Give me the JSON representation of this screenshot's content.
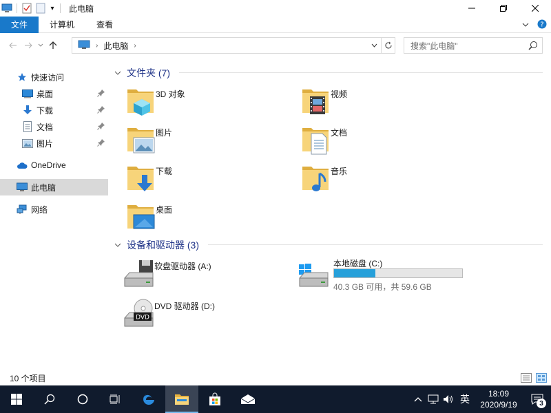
{
  "window": {
    "title": "此电脑",
    "qa_dropdown": "▾"
  },
  "ribbon": {
    "tabs": [
      "文件",
      "计算机",
      "查看"
    ]
  },
  "address": {
    "location": "此电脑",
    "search_placeholder": "搜索\"此电脑\""
  },
  "sidebar": {
    "quick_access": "快速访问",
    "items": [
      "桌面",
      "下载",
      "文档",
      "图片"
    ],
    "onedrive": "OneDrive",
    "this_pc": "此电脑",
    "network": "网络"
  },
  "folders_group": {
    "title": "文件夹 (7)",
    "items": [
      "3D 对象",
      "视频",
      "图片",
      "文档",
      "下载",
      "音乐",
      "桌面"
    ]
  },
  "devices_group": {
    "title": "设备和驱动器 (3)",
    "floppy": "软盘驱动器 (A:)",
    "local_disk": "本地磁盘 (C:)",
    "local_disk_free": "40.3 GB 可用，共 59.6 GB",
    "local_disk_used_fraction": 0.32,
    "dvd": "DVD 驱动器 (D:)",
    "dvd_text": "DVD"
  },
  "status": {
    "count": "10 个项目"
  },
  "taskbar": {
    "ime": "英",
    "time": "18:09",
    "date": "2020/9/19",
    "notifications": "3"
  },
  "colors": {
    "accent": "#1979ca",
    "taskbar": "#101b2d",
    "folder": "#f0c55a",
    "progress": "#26a0da",
    "group_title": "#1e3287"
  }
}
